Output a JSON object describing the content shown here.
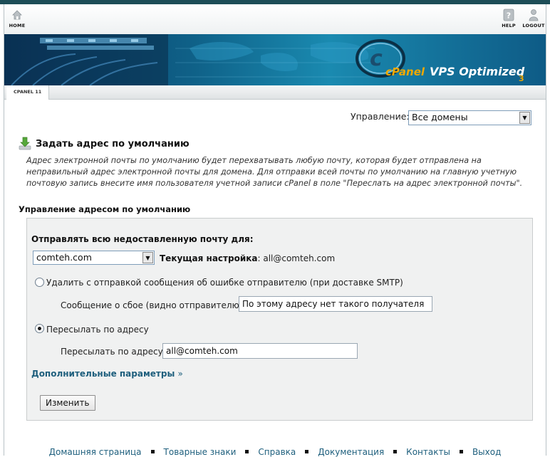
{
  "topbar": {
    "home_label": "HOME",
    "help_label": "HELP",
    "logout_label": "LOGOUT"
  },
  "banner": {
    "logo_text": "cPanel",
    "tagline": "VPS Optimized",
    "version_mark": "3"
  },
  "tabs": [
    {
      "label": "CPANEL 11"
    }
  ],
  "manage": {
    "label": "Управление:",
    "selected": "Все домены"
  },
  "page": {
    "title": "Задать адрес по умолчанию",
    "description": "Адрес электронной почты по умолчанию будет перехватывать любую почту, которая будет отправлена на неправильный адрес электронной почты для домена. Для отправки всей почты по умолчанию на главную учетную почтовую запись внесите имя пользователя учетной записи cPanel в поле \"Переслать на адрес электронной почты\"."
  },
  "section": {
    "title": "Управление адресом по умолчанию"
  },
  "form": {
    "send_all_label": "Отправлять всю недоставленную почту для:",
    "domain_selected": "comteh.com",
    "current_setting_label": "Текущая настройка",
    "current_setting_value": ": all@comteh.com",
    "option_bounce_label": "Удалить с отправкой сообщения об ошибке отправителю (при доставке SMTP)",
    "failure_message_label": "Сообщение о сбое (видно отправителю):",
    "failure_message_value": "По этому адресу нет такого получателя",
    "option_forward_label": "Пересылать по адресу",
    "forward_label": "Пересылать по адресу:",
    "forward_value": "all@comteh.com",
    "advanced_link": "Дополнительные параметры",
    "advanced_arrow": "»",
    "submit_label": "Изменить",
    "selected_option": "forward"
  },
  "footer": {
    "links": [
      "Домашняя страница",
      "Товарные знаки",
      "Справка",
      "Документация",
      "Контакты",
      "Выход"
    ]
  }
}
